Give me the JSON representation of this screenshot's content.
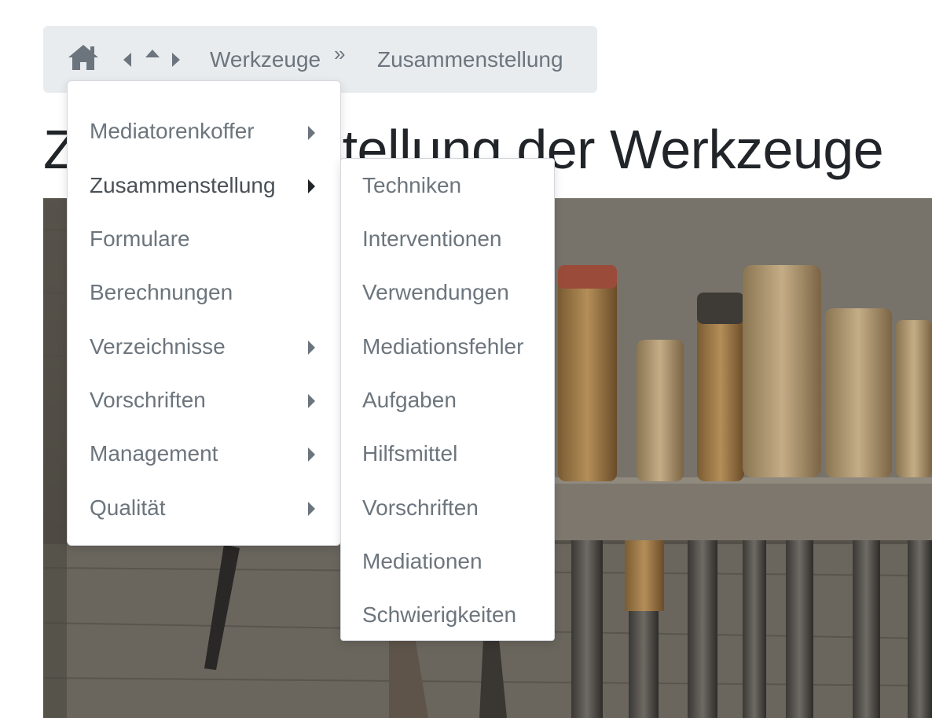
{
  "breadcrumb": {
    "home_icon": "home-icon",
    "nav_icons": [
      "caret-left-icon",
      "caret-up-icon",
      "caret-right-icon"
    ],
    "items": [
      {
        "label": "Werkzeuge"
      },
      {
        "separator": "»"
      },
      {
        "label": "Zusammenstellung"
      }
    ]
  },
  "page": {
    "title": "Zusammenstellung der Werkzeuge",
    "hero_image": "tools-on-workbench-photo"
  },
  "menu_main": {
    "items": [
      {
        "label": "Mediatorenkoffer",
        "has_submenu": true
      },
      {
        "label": "Zusammenstellung",
        "has_submenu": true,
        "active": true
      },
      {
        "label": "Formulare",
        "has_submenu": false
      },
      {
        "label": "Berechnungen",
        "has_submenu": false
      },
      {
        "label": "Verzeichnisse",
        "has_submenu": true
      },
      {
        "label": "Vorschriften",
        "has_submenu": true
      },
      {
        "label": "Management",
        "has_submenu": true
      },
      {
        "label": "Qualität",
        "has_submenu": true
      }
    ]
  },
  "menu_sub": {
    "items": [
      {
        "label": "Techniken"
      },
      {
        "label": "Interventionen"
      },
      {
        "label": "Verwendungen"
      },
      {
        "label": "Mediationsfehler"
      },
      {
        "label": "Aufgaben"
      },
      {
        "label": "Hilfsmittel"
      },
      {
        "label": "Vorschriften"
      },
      {
        "label": "Mediationen"
      },
      {
        "label": "Schwierigkeiten"
      }
    ]
  },
  "colors": {
    "breadcrumb_bg": "#e9ecef",
    "muted_text": "#6c757d",
    "title_text": "#212529",
    "menu_bg": "#ffffff"
  }
}
